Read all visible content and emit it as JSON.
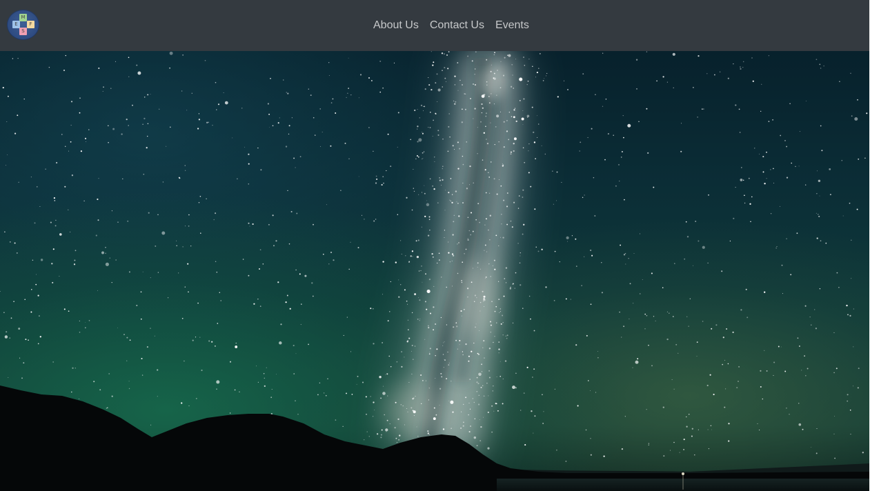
{
  "navbar": {
    "logo": {
      "letters": [
        "M",
        "E",
        "F",
        "S"
      ]
    },
    "links": [
      {
        "label": "About Us"
      },
      {
        "label": "Contact Us"
      },
      {
        "label": "Events"
      }
    ]
  },
  "hero": {
    "image": "night-sky-milky-way-over-mountains-and-lake"
  },
  "colors": {
    "navbar_bg": "#343a40",
    "nav_link": "#c6c8ca"
  }
}
